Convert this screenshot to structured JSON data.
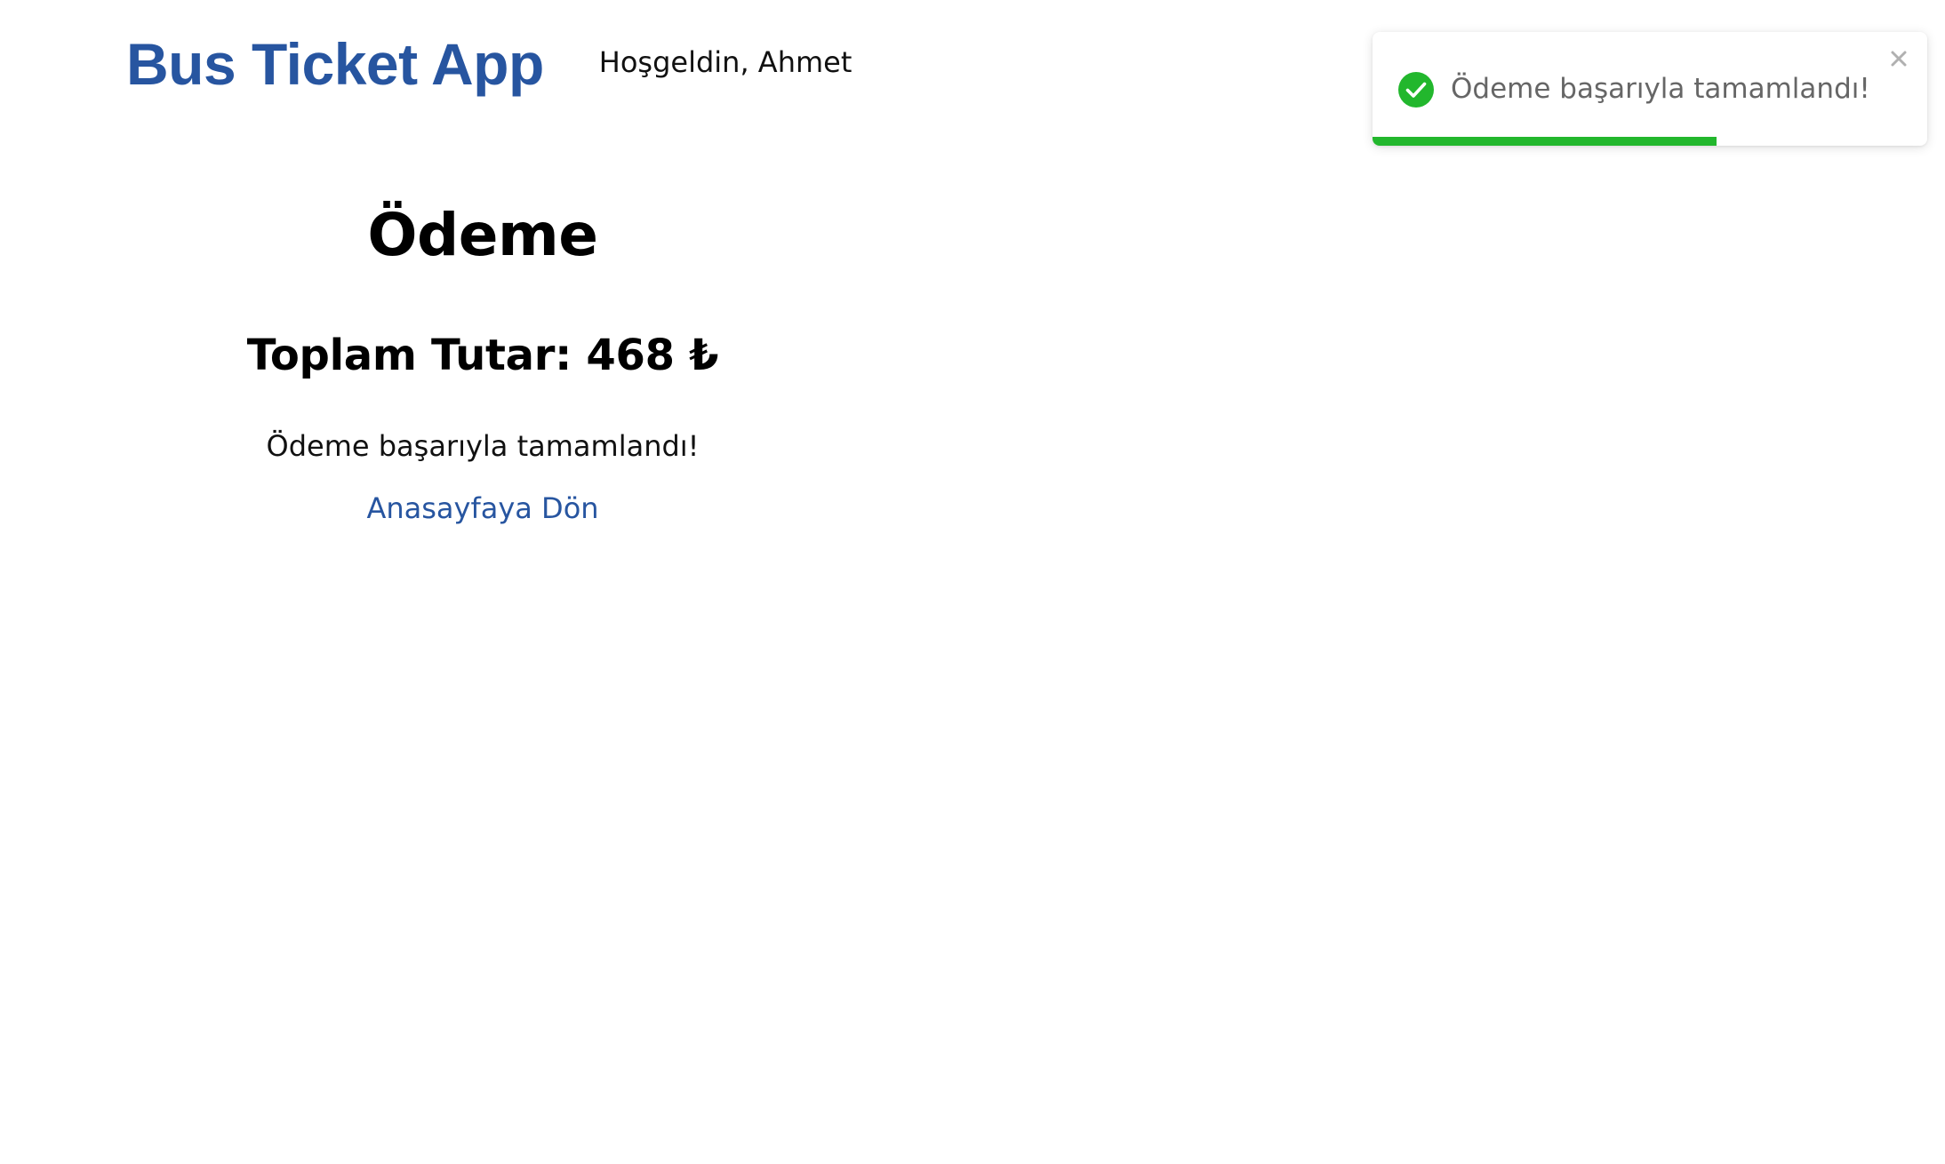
{
  "header": {
    "app_title": "Bus Ticket App",
    "welcome_text": "Hoşgeldin, Ahmet"
  },
  "main": {
    "title": "Ödeme",
    "total_amount": "Toplam Tutar: 468 ₺",
    "success_message": "Ödeme başarıyla tamamlandı!",
    "home_link": "Anasayfaya Dön"
  },
  "toast": {
    "message": "Ödeme başarıyla tamamlandı!",
    "status_icon": "check-circle-icon",
    "close_icon": "close-icon",
    "progress": 0.62
  },
  "colors": {
    "brand": "#2755a0",
    "success": "#22b72d",
    "toast_text": "#666666",
    "close_icon": "#b0b0b0"
  }
}
